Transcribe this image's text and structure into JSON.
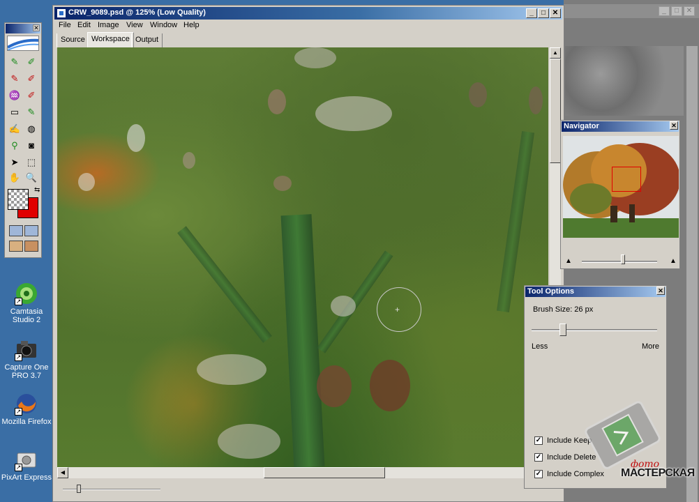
{
  "desktop": {
    "icons": [
      {
        "label": "Camtasia Studio 2",
        "icon": "camtasia-icon"
      },
      {
        "label": "Capture One PRO 3.7",
        "icon": "camera-icon"
      },
      {
        "label": "Mozilla Firefox",
        "icon": "firefox-icon"
      },
      {
        "label": "PixArt Express",
        "icon": "camera-icon"
      }
    ]
  },
  "window": {
    "title": "CRW_9089.psd @ 125% (Low Quality)",
    "controls": {
      "minimize": "_",
      "maximize": "□",
      "close": "✕"
    }
  },
  "menu": [
    "File",
    "Edit",
    "Image",
    "View",
    "Window",
    "Help"
  ],
  "tabs": [
    {
      "label": "Source",
      "active": false
    },
    {
      "label": "Workspace",
      "active": true
    },
    {
      "label": "Output",
      "active": false
    }
  ],
  "navigator": {
    "title": "Navigator",
    "zoom_level": 0.55
  },
  "tool_options": {
    "title": "Tool Options",
    "brush_size_label": "Brush Size: 26 px",
    "brush_size_px": 26,
    "less_label": "Less",
    "more_label": "More",
    "checkboxes": [
      {
        "label": "Include Keep",
        "checked": true
      },
      {
        "label": "Include Delete",
        "checked": true
      },
      {
        "label": "Include Complex",
        "checked": true
      }
    ]
  },
  "watermark": {
    "line1": "фото",
    "line2": "МАСТЕРСКАЯ"
  },
  "colors": {
    "titlebar_start": "#0a246a",
    "titlebar_end": "#a6caf0",
    "foreground_swatch": "transparent",
    "background_swatch": "#e00000"
  }
}
